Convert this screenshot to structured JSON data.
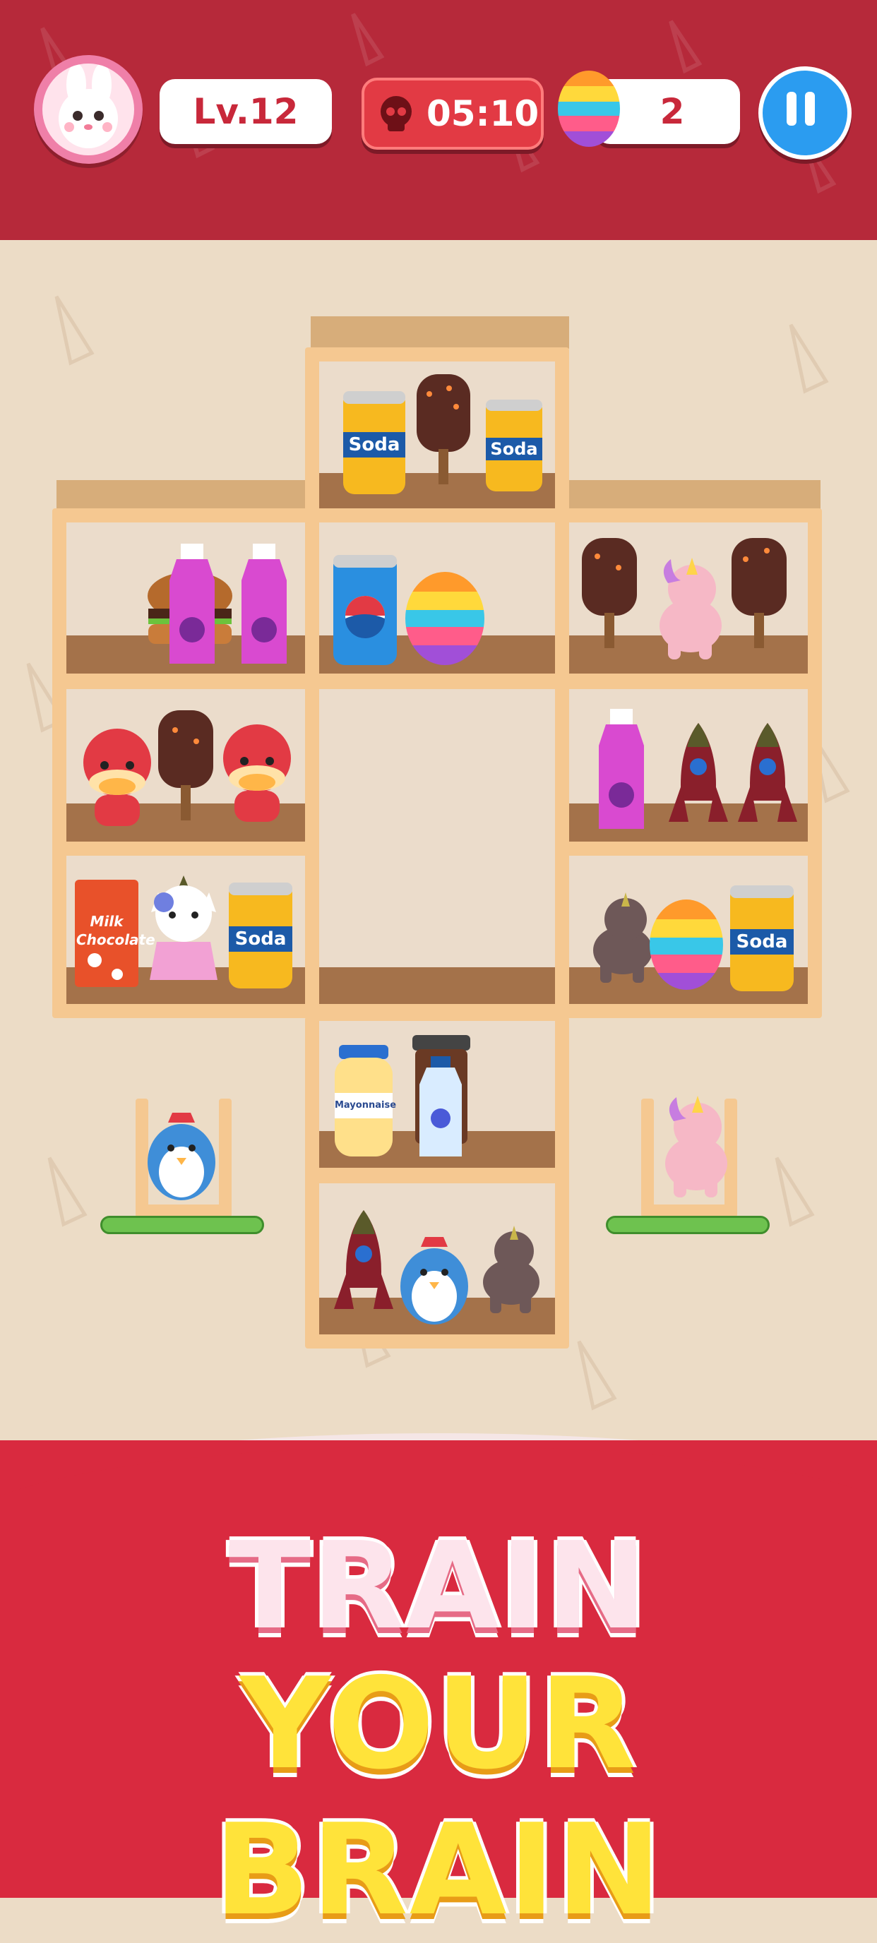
{
  "hud": {
    "level": "Lv.12",
    "timer": "05:10",
    "eggs": "2",
    "avatar": "bunny-avatar",
    "pause_icon": "pause-icon"
  },
  "items": {
    "soda_label": "Soda",
    "milk_label": "Milk Chocolate",
    "mayo_label": "Mayonnaise"
  },
  "banner": {
    "line1": "TRAIN",
    "line2": "YOUR BRAIN"
  },
  "colors": {
    "header": "#b6293a",
    "background": "#ecdcc6",
    "banner": "#d92a3f",
    "title_yellow": "#ffe33a",
    "title_pink": "#fde4ec"
  }
}
